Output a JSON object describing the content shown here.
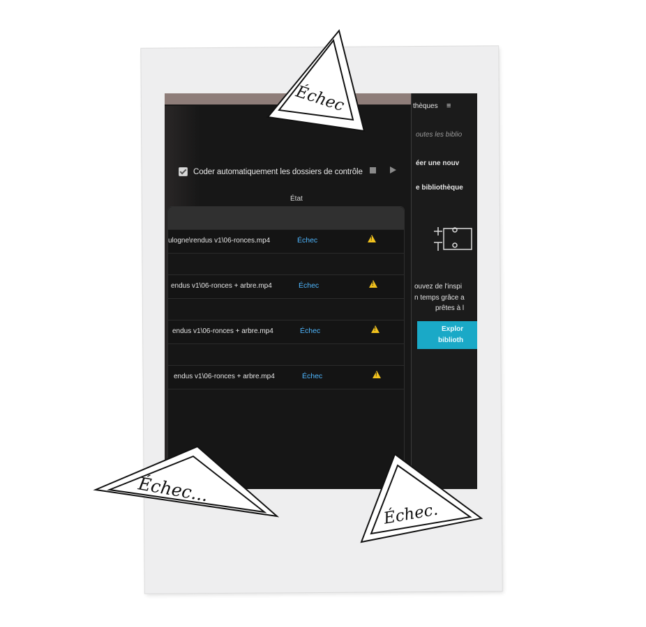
{
  "app": {
    "header_partial": "thèques",
    "menu_icon": "hamburger-icon",
    "autocode_label": "Coder automatiquement les dossiers de contrôle",
    "autocode_checked": true,
    "column_status_header": "État"
  },
  "rows": [
    {
      "path": "ulogne\\rendus v1\\06-ronces.mp4",
      "status": "Échec",
      "icon": "warning-icon"
    },
    {
      "path": "endus v1\\06-ronces + arbre.mp4",
      "status": "Échec",
      "icon": "warning-icon"
    },
    {
      "path": "endus v1\\06-ronces + arbre.mp4",
      "status": "Échec",
      "icon": "warning-icon"
    },
    {
      "path": "endus v1\\06-ronces + arbre.mp4",
      "status": "Échec",
      "icon": "warning-icon"
    }
  ],
  "side_panel": {
    "filter_text": "outes les biblio",
    "create_text": "éer une nouv",
    "library_text": "e bibliothèque",
    "desc_line1": "ouvez de l'inspi",
    "desc_line2": "n temps grâce a",
    "desc_line3": "prêtes à l",
    "button_line1": "Explor",
    "button_line2": "biblioth"
  },
  "stickers": {
    "top": "Échec",
    "bottom_left": "Échec...",
    "bottom_right": "Échec."
  },
  "colors": {
    "status_link": "#4fb7ff",
    "warning": "#f2c21d",
    "accent_button": "#1aa9c7",
    "polaroid_frame": "#eeeeef"
  }
}
